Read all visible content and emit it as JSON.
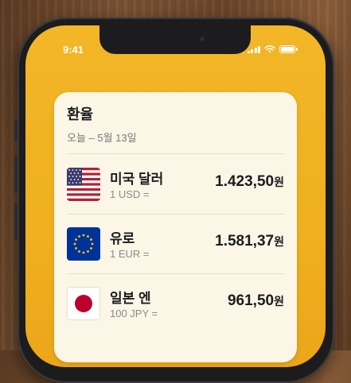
{
  "status_bar": {
    "time": "9:41"
  },
  "widget": {
    "title": "환율",
    "date": "오늘 – 5월 13일",
    "rates": [
      {
        "name": "미국 달러",
        "unit": "1 USD =",
        "value": "1.423,50",
        "currency_suffix": "원",
        "flag_icon": "us-flag-icon"
      },
      {
        "name": "유로",
        "unit": "1 EUR =",
        "value": "1.581,37",
        "currency_suffix": "원",
        "flag_icon": "eu-flag-icon"
      },
      {
        "name": "일본 엔",
        "unit": "100 JPY =",
        "value": "961,50",
        "currency_suffix": "원",
        "flag_icon": "japan-flag-icon"
      }
    ]
  },
  "colors": {
    "wallpaper": "#f2b626",
    "widget_bg": "#fbf6e6",
    "us_red": "#b22234",
    "us_blue": "#3c3b6e",
    "eu_blue": "#003399",
    "eu_star": "#ffcc00",
    "jp_red": "#bc002d"
  }
}
